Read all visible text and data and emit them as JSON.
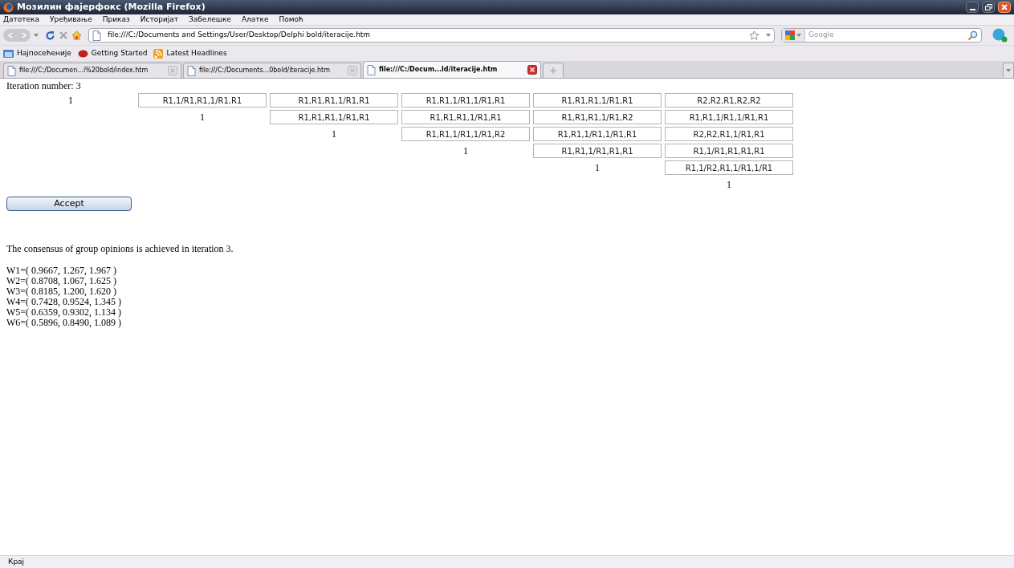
{
  "window": {
    "title": "Мозилин фајерфокс (Mozilla Firefox)"
  },
  "menu": [
    "Датотека",
    "Уређивање",
    "Приказ",
    "Историјат",
    "Забелешке",
    "Алатке",
    "Помоћ"
  ],
  "address": {
    "value": "file:///C:/Documents and Settings/User/Desktop/Delphi bold/iteracije.htm"
  },
  "search": {
    "placeholder": "Google"
  },
  "bookmarks": [
    "Најпосећеније",
    "Getting Started",
    "Latest Headlines"
  ],
  "tabs": [
    {
      "label": "file:///C:/Documen...i%20bold/index.htm",
      "selected": false
    },
    {
      "label": "file:///C:/Documents...0bold/iteracije.htm",
      "selected": false
    },
    {
      "label": "file:///C:/Docum...ld/iteracije.htm",
      "selected": true
    }
  ],
  "page": {
    "iteration_label": "Iteration number: 3",
    "matrix": [
      {
        "diagonal": "1",
        "cells": [
          "R1,1/R1,R1,1/R1,R1",
          "R1,R1,R1,1/R1,R1",
          "R1,R1,1/R1,1/R1,R1",
          "R1,R1,R1,1/R1,R1",
          "R2,R2,R1,R2,R2"
        ]
      },
      {
        "diagonal": "1",
        "cells": [
          "R1,R1,R1,1/R1,R1",
          "R1,R1,R1,1/R1,R1",
          "R1,R1,R1,1/R1,R2",
          "R1,R1,1/R1,1/R1,R1"
        ]
      },
      {
        "diagonal": "1",
        "cells": [
          "R1,R1,1/R1,1/R1,R2",
          "R1,R1,1/R1,1/R1,R1",
          "R2,R2,R1,1/R1,R1"
        ]
      },
      {
        "diagonal": "1",
        "cells": [
          "R1,R1,1/R1,R1,R1",
          "R1,1/R1,R1,R1,R1"
        ]
      },
      {
        "diagonal": "1",
        "cells": [
          "R1,1/R2,R1,1/R1,1/R1"
        ]
      },
      {
        "diagonal": "1"
      }
    ],
    "accept_button": "Accept",
    "consensus": "The consensus of group opinions is achieved in iteration 3.",
    "weights": [
      "W1=( 0.9667, 1.267, 1.967 )",
      "W2=( 0.8708, 1.067, 1.625 )",
      "W3=( 0.8185, 1.200, 1.620 )",
      "W4=( 0.7428, 0.9524, 1.345 )",
      "W5=( 0.6359, 0.9302, 1.134 )",
      "W6=( 0.5896, 0.8490, 1.089 )"
    ]
  },
  "status_bar": "Крај"
}
